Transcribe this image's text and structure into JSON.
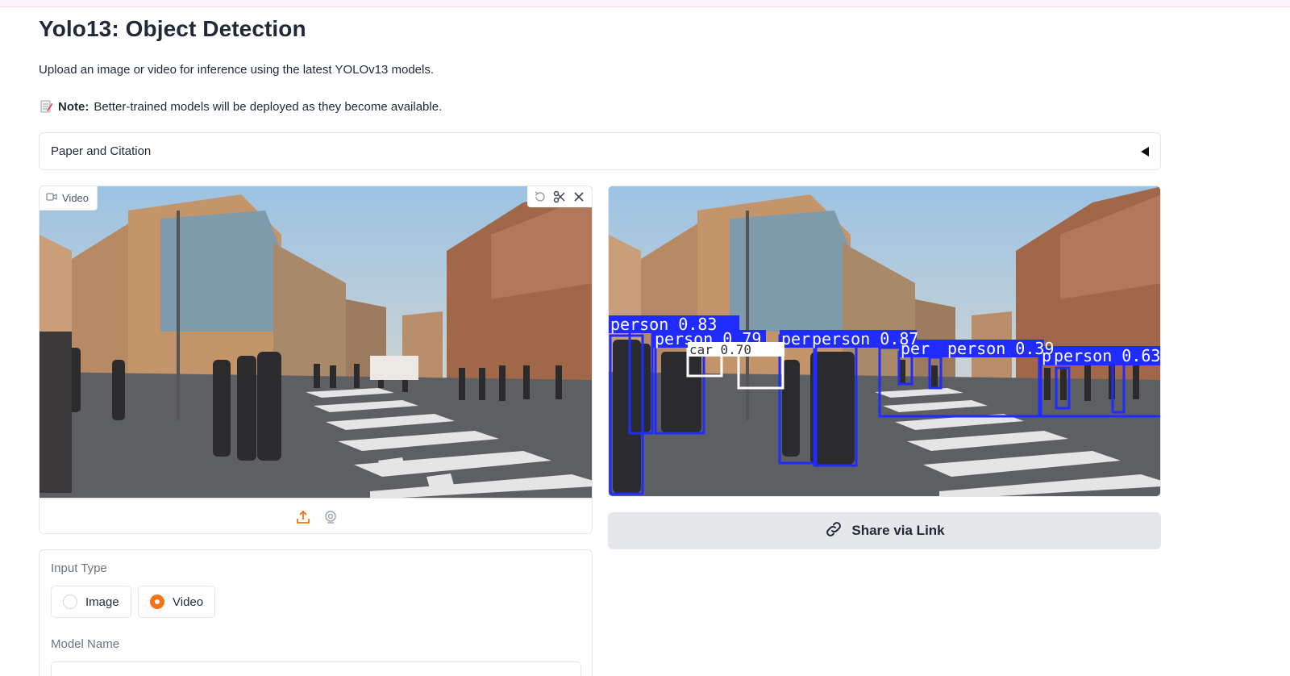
{
  "page": {
    "title": "Yolo13: Object Detection",
    "description": "Upload an image or video for inference using the latest YOLOv13 models.",
    "note_bold": "Note:",
    "note_text": "Better-trained models will be deployed as they become available."
  },
  "accordion": {
    "label": "Paper and Citation"
  },
  "input_video": {
    "label": "Video",
    "tools": [
      "undo-icon",
      "scissors-icon",
      "close-icon"
    ],
    "bottom_actions": [
      "upload-icon",
      "webcam-icon"
    ]
  },
  "output": {
    "detections": [
      {
        "label": "person 0.83"
      },
      {
        "label": "person 0.79"
      },
      {
        "label": "person 0.87"
      },
      {
        "label": "person 0.39"
      },
      {
        "label": "person 0.63"
      },
      {
        "label": "car 0.70"
      }
    ]
  },
  "share": {
    "label": "Share via Link",
    "icon": "link-icon"
  },
  "form": {
    "input_type_label": "Input Type",
    "options": [
      {
        "label": "Image",
        "checked": false
      },
      {
        "label": "Video",
        "checked": true
      }
    ],
    "model_name_label": "Model Name"
  },
  "colors": {
    "accent": "#f97316",
    "detection_box": "#1f2bff"
  }
}
